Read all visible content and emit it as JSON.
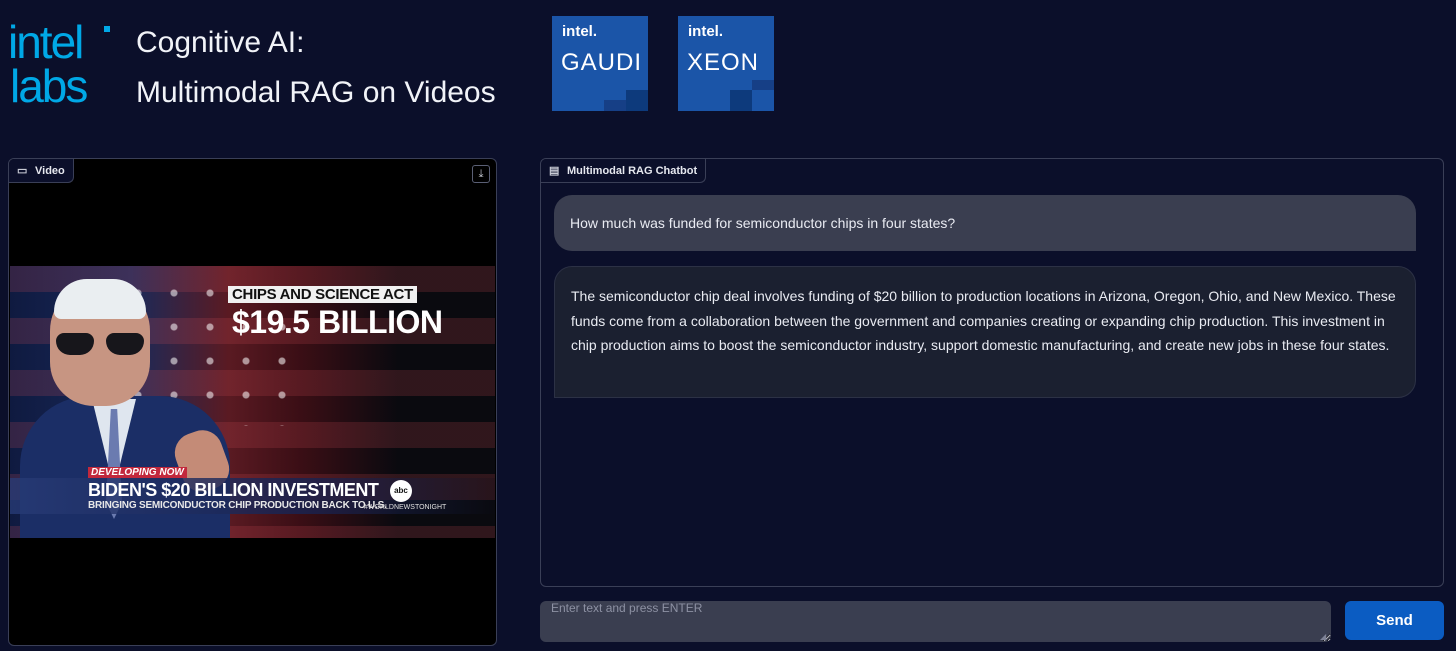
{
  "header": {
    "logo_line1": "intel",
    "logo_line2": "labs",
    "title_line1": "Cognitive AI:",
    "title_line2": "Multimodal RAG on Videos",
    "badges": [
      {
        "brand": "intel.",
        "product": "GAUDI"
      },
      {
        "brand": "intel.",
        "product": "XEON"
      }
    ]
  },
  "video_panel": {
    "label": "Video",
    "label_icon": "video-camera-icon",
    "download_icon": "download-icon",
    "overlay": {
      "banner": "CHIPS AND SCIENCE ACT",
      "amount": "$19.5 BILLION",
      "tag": "DEVELOPING NOW",
      "headline": "BIDEN'S $20 BILLION INVESTMENT",
      "subline": "BRINGING SEMICONDUCTOR CHIP PRODUCTION BACK TO U.S.",
      "network": "abc",
      "hashtag": "#WORLDNEWSTONIGHT"
    }
  },
  "chat_panel": {
    "label": "Multimodal RAG Chatbot",
    "label_icon": "chat-bubble-icon",
    "messages": [
      {
        "role": "user",
        "text": "How much was funded for semiconductor chips in four states?"
      },
      {
        "role": "bot",
        "text": "The semiconductor chip deal involves funding of $20 billion to production locations in Arizona, Oregon, Ohio, and New Mexico. These funds come from a collaboration between the government and companies creating or expanding chip production. This investment in chip production aims to boost the semiconductor industry, support domestic manufacturing, and create new jobs in these four states."
      }
    ]
  },
  "input": {
    "placeholder": "Enter text and press ENTER",
    "value": ""
  },
  "send_button": {
    "label": "Send"
  },
  "colors": {
    "background": "#0b0f2a",
    "accent": "#00a8e6",
    "send": "#0b5cc2",
    "badge": "#1b55a8"
  }
}
